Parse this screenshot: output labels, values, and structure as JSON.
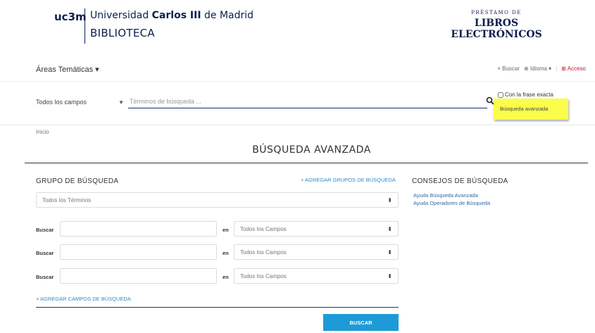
{
  "header": {
    "logo_text": "uc3m",
    "univ_prefix": "Universidad ",
    "univ_bold": "Carlos III",
    "univ_suffix": " de Madrid",
    "biblioteca": "BIBLIOTECA",
    "prestamo": "PRÉSTAMO DE",
    "libros_line1": "LIBROS",
    "libros_line2": "ELECTRÓNICOS"
  },
  "nav": {
    "areas": "Áreas Temáticas ▾",
    "buscar": "× Buscar",
    "idioma": "⊕ Idioma ▾",
    "separator": "|",
    "acceso": "⊞ Acceso"
  },
  "search": {
    "field_select": "Todos los campos",
    "placeholder": "Términos de búsqueda ...",
    "exact_phrase": "Con la frase exacta",
    "advanced_link": "Búsqueda avanzada"
  },
  "main": {
    "breadcrumb": "Inicio",
    "title": "BÚSQUEDA AVANZADA",
    "grupo_title": "GRUPO DE BÚSQUEDA",
    "add_groups": "+ AGREGAR GRUPOS DE BÚSQUEDA",
    "group_select": "Todos los Términos",
    "rows": [
      {
        "label": "Buscar",
        "en": "en",
        "field": "Todos los Campos"
      },
      {
        "label": "Buscar",
        "en": "en",
        "field": "Todos los Campos"
      },
      {
        "label": "Buscar",
        "en": "en",
        "field": "Todos los Campos"
      }
    ],
    "add_fields": "+ AGREGAR CAMPOS DE BÚSQUEDA",
    "buscar_button": "BUSCAR"
  },
  "consejos": {
    "title": "CONSEJOS DE BÚSQUEDA",
    "links": [
      "Ayuda Búsqueda Avanzada",
      "Ayuda Operadores de Búsqueda"
    ]
  },
  "colors": {
    "brand_navy": "#0b1f4d",
    "link_blue": "#2e8bc9",
    "button_blue": "#1e9bd7",
    "highlight_yellow": "#fafd4a",
    "acceso_red": "#c8102e"
  }
}
